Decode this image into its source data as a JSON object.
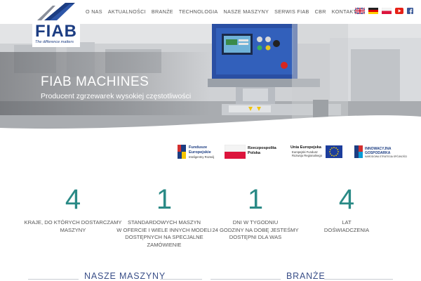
{
  "logo": {
    "text": "FIAB",
    "tagline": "The difference matters"
  },
  "nav": {
    "items": [
      "O NAS",
      "AKTUALNOŚCI",
      "BRANŻE",
      "TECHNOLOGIA",
      "NASZE MASZYNY",
      "SERWIS FIAB",
      "CBR",
      "KONTAKT"
    ]
  },
  "header_icons": {
    "flags": [
      "uk-flag-icon",
      "germany-flag-icon",
      "poland-flag-icon"
    ],
    "social": [
      "youtube-icon",
      "facebook-icon"
    ]
  },
  "hero": {
    "title": "FIAB MACHINES",
    "subtitle": "Producent zgrzewarek wysokiej częstotliwości"
  },
  "funding": {
    "fe_line1": "Fundusze",
    "fe_line2": "Europejskie",
    "fe_line3": "Inteligentny Rozwój",
    "rp_line1": "Rzeczpospolita",
    "rp_line2": "Polska",
    "ue_line1": "Unia Europejska",
    "ue_line2": "Europejski Fundusz",
    "ue_line3": "Rozwoju Regionalnego",
    "ig_line1": "INNOWACYJNA",
    "ig_line2": "GOSPODARKA",
    "ig_line3": "NARODOWA STRATEGIA SPÓJNOŚCI"
  },
  "stats": [
    {
      "number": "4",
      "label_lines": [
        "KRAJE, DO KTÓRYCH DOSTARCZAMY",
        "MASZYNY"
      ]
    },
    {
      "number": "1",
      "label_lines": [
        "STANDARDOWYCH MASZYN",
        "W OFERCIE I WIELE INNYCH MODELI",
        "DOSTĘPNYCH NA SPECJALNE",
        "ZAMÓWIENIE"
      ]
    },
    {
      "number": "1",
      "label_lines": [
        "DNI W TYGODNIU",
        "24 GODZINY NA DOBĘ JESTEŚMY",
        "DOSTĘPNI DLA WAS"
      ]
    },
    {
      "number": "4",
      "label_lines": [
        "LAT",
        "DOŚWIADCZENIA"
      ]
    }
  ],
  "sections": {
    "machines": "NASZE MASZYNY",
    "branches": "BRANŻE"
  },
  "colors": {
    "brand_blue": "#1c3d82",
    "accent_teal": "#2a8a86",
    "heading_blue": "#3a4f88"
  }
}
